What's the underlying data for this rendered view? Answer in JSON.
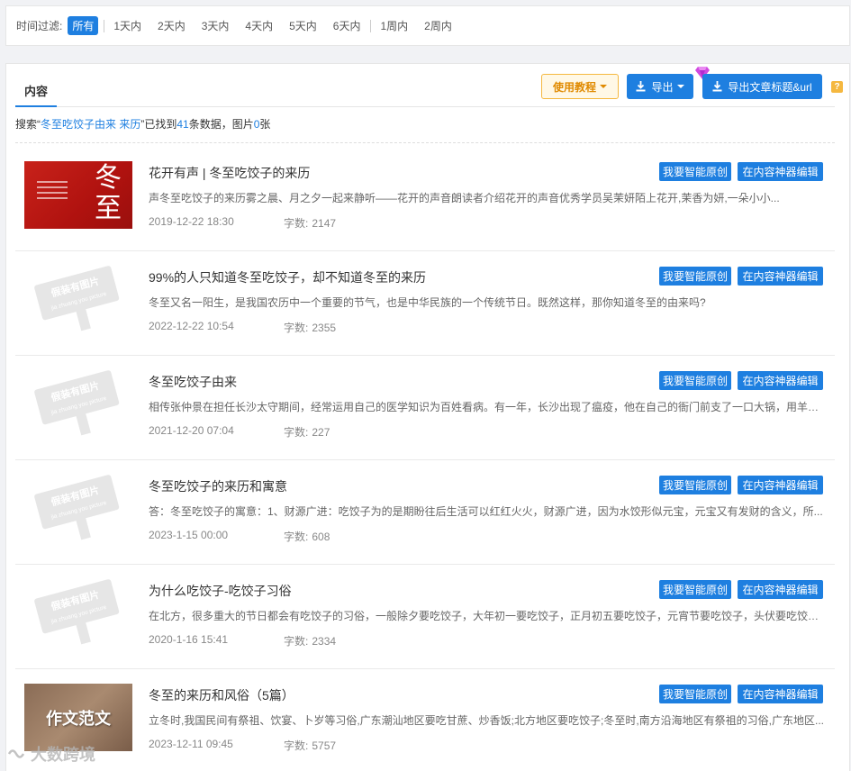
{
  "filter": {
    "label": "时间过滤:",
    "options": [
      "所有",
      "1天内",
      "2天内",
      "3天内",
      "4天内",
      "5天内",
      "6天内",
      "1周内",
      "2周内"
    ],
    "active": "所有"
  },
  "panel": {
    "tab": "内容",
    "tutorial_label": "使用教程",
    "export_label": "导出",
    "export_title_label": "导出文章标题&url",
    "help": "?"
  },
  "summary": {
    "prefix": "搜索“",
    "query": "冬至吃饺子由来 来历",
    "mid1": "”已找到",
    "count": "41",
    "mid2": "条数据，图片",
    "images": "0",
    "suffix": "张"
  },
  "row_actions": {
    "original_label": "我要智能原创",
    "edit_label": "在内容神器编辑"
  },
  "word_count_label": "字数:",
  "placeholder_text": {
    "line1": "假装有图片",
    "line2": "jia zhuang you picture"
  },
  "essay_thumb_text": "作文范文",
  "items": [
    {
      "title": "花开有声 | 冬至吃饺子的来历",
      "desc": "声冬至吃饺子的来历雾之晨、月之夕一起来静听——花开的声音朗读者介绍花开的声音优秀学员吴茉妍陌上花开,茉香为妍,一朵小小...",
      "date": "2019-12-22 18:30",
      "words": "2147",
      "thumb": "red",
      "red_glyph": "冬\n至"
    },
    {
      "title": "99%的人只知道冬至吃饺子，却不知道冬至的来历",
      "desc": "冬至又名一阳生，是我国农历中一个重要的节气，也是中华民族的一个传统节日。既然这样，那你知道冬至的由来吗?",
      "date": "2022-12-22 10:54",
      "words": "2355",
      "thumb": "placeholder"
    },
    {
      "title": "冬至吃饺子由来",
      "desc": "相传张仲景在担任长沙太守期间，经常运用自己的医学知识为百姓看病。有一年，长沙出现了瘟疫，他在自己的衙门前支了一口大锅，用羊肉...",
      "date": "2021-12-20 07:04",
      "words": "227",
      "thumb": "placeholder"
    },
    {
      "title": "冬至吃饺子的来历和寓意",
      "desc": "答：冬至吃饺子的寓意：1、财源广进：吃饺子为的是期盼往后生活可以红红火火，财源广进，因为水饺形似元宝，元宝又有发财的含义，所...",
      "date": "2023-1-15 00:00",
      "words": "608",
      "thumb": "placeholder"
    },
    {
      "title": "为什么吃饺子-吃饺子习俗",
      "desc": "在北方，很多重大的节日都会有吃饺子的习俗，一般除夕要吃饺子，大年初一要吃饺子，正月初五要吃饺子，元宵节要吃饺子，头伏要吃饺子...",
      "date": "2020-1-16 15:41",
      "words": "2334",
      "thumb": "placeholder"
    },
    {
      "title": "冬至的来历和风俗（5篇）",
      "desc": "立冬时,我国民间有祭祖、饮宴、卜岁等习俗,广东潮汕地区要吃甘蔗、炒香饭;北方地区要吃饺子;冬至时,南方沿海地区有祭祖的习俗,广东地区...",
      "date": "2023-12-11 09:45",
      "words": "5757",
      "thumb": "essay"
    }
  ],
  "watermark": "大数跨境",
  "colors": {
    "accent": "#1e7fe0",
    "tutorial_border": "#f5b840",
    "tutorial_text": "#e08a00"
  }
}
